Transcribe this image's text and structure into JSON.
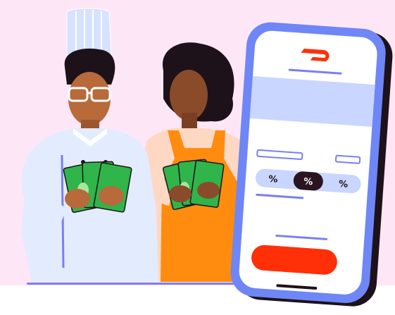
{
  "phone": {
    "tip_options": [
      "%",
      "%",
      "%"
    ],
    "selected_tip_index": 1
  },
  "colors": {
    "background": "#fde7f6",
    "phone_frame": "#6f86f6",
    "brand_red": "#ff3008",
    "accent_bar": "#c9d6ff",
    "chef_coat": "#e3ebff",
    "apron": "#ff8c0f",
    "cash_green": "#2fb54a",
    "skin": "#8a4b2a",
    "dark": "#1d1219"
  },
  "icons": {
    "brand_logo": "doordash-logo-icon"
  }
}
